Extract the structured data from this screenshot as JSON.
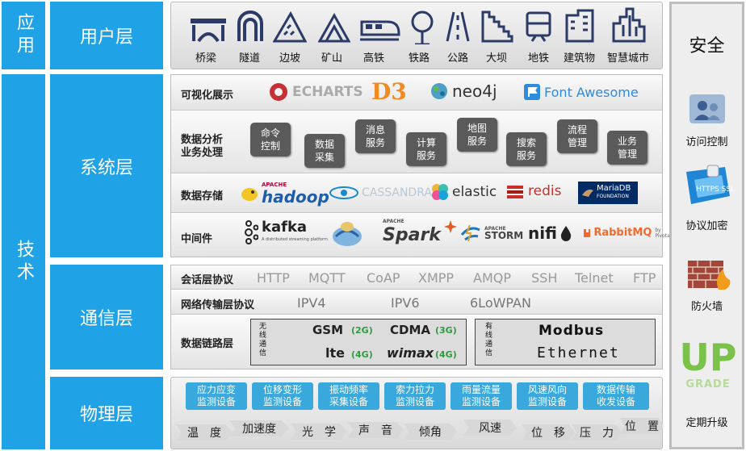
{
  "left_groups": [
    {
      "id": "app",
      "label": "应用"
    },
    {
      "id": "tech",
      "label": "技术"
    }
  ],
  "layers": [
    {
      "id": "user",
      "label": "用户层"
    },
    {
      "id": "system",
      "label": "系统层"
    },
    {
      "id": "comm",
      "label": "通信层"
    },
    {
      "id": "physical",
      "label": "物理层"
    }
  ],
  "user_layer": {
    "items": [
      {
        "label": "桥梁",
        "icon": "bridge-icon"
      },
      {
        "label": "隧道",
        "icon": "tunnel-icon"
      },
      {
        "label": "边坡",
        "icon": "slope-icon"
      },
      {
        "label": "矿山",
        "icon": "mountain-icon"
      },
      {
        "label": "高铁",
        "icon": "bullet-train-icon"
      },
      {
        "label": "铁路",
        "icon": "railway-sign-icon"
      },
      {
        "label": "公路",
        "icon": "road-icon"
      },
      {
        "label": "大坝",
        "icon": "dam-icon"
      },
      {
        "label": "地铁",
        "icon": "subway-icon"
      },
      {
        "label": "建筑物",
        "icon": "building-icon"
      },
      {
        "label": "智慧城市",
        "icon": "city-icon"
      }
    ]
  },
  "system_layer": {
    "viz": {
      "label": "可视化展示",
      "logos": [
        "ECHARTS",
        "D3",
        "neo4j",
        "Font Awesome"
      ]
    },
    "analysis": {
      "label1": "数据分析",
      "label2": "业务处理",
      "services": [
        {
          "l1": "命令",
          "l2": "控制"
        },
        {
          "l1": "数据",
          "l2": "采集"
        },
        {
          "l1": "消息",
          "l2": "服务"
        },
        {
          "l1": "计算",
          "l2": "服务"
        },
        {
          "l1": "地图",
          "l2": "服务"
        },
        {
          "l1": "搜索",
          "l2": "服务"
        },
        {
          "l1": "流程",
          "l2": "管理"
        },
        {
          "l1": "业务",
          "l2": "管理"
        }
      ]
    },
    "storage": {
      "label": "数据存储",
      "hadoop_top": "APACHE",
      "hadoop": "hadoop",
      "cassandra": "CASSANDRA",
      "elastic": "elastic",
      "redis": "redis",
      "mariadb": "MariaDB",
      "mariadb_sub": "FOUNDATION"
    },
    "middleware": {
      "label": "中间件",
      "kafka": "kafka",
      "kafka_sub": "A distributed streaming platform",
      "spark_top": "APACHE",
      "spark": "Spark",
      "storm_top": "APACHE",
      "storm": "STORM",
      "nifi": "nifi",
      "rabbitmq": "RabbitMQ",
      "rabbitmq_by": "by Pivotal"
    }
  },
  "comm_layer": {
    "session": {
      "label": "会话层协议",
      "protocols": [
        "HTTP",
        "MQTT",
        "CoAP",
        "XMPP",
        "AMQP",
        "SSH",
        "Telnet",
        "FTP"
      ]
    },
    "network": {
      "label": "网络传输层协议",
      "protocols": [
        "IPV4",
        "IPV6",
        "6LoWPAN"
      ]
    },
    "datalink": {
      "label": "数据链路层",
      "wireless": {
        "label": "无线通信",
        "gsm": "GSM",
        "gsm_gen": "(2G)",
        "cdma": "CDMA",
        "cdma_gen": "(3G)",
        "lte": "lte",
        "lte_gen": "(4G)",
        "wimax": "wimax",
        "wimax_gen": "(4G)"
      },
      "wired": {
        "label": "有线通信",
        "modbus": "Modbus",
        "ethernet": "Ethernet"
      }
    }
  },
  "physical_layer": {
    "sensors": [
      {
        "l1": "应力应变",
        "l2": "监测设备"
      },
      {
        "l1": "位移变形",
        "l2": "监测设备"
      },
      {
        "l1": "振动频率",
        "l2": "采集设备"
      },
      {
        "l1": "索力拉力",
        "l2": "监测设备"
      },
      {
        "l1": "雨量流量",
        "l2": "监测设备"
      },
      {
        "l1": "风速风向",
        "l2": "监测设备"
      },
      {
        "l1": "数据传输",
        "l2": "收发设备"
      }
    ],
    "quantities": [
      "温　度",
      "加速度",
      "光　学",
      "声　音",
      "倾角",
      "风速",
      "位　移",
      "压　力",
      "位　置"
    ]
  },
  "security": {
    "title": "安全",
    "items": [
      {
        "label": "访问控制",
        "icon": "access-control-icon"
      },
      {
        "label": "协议加密",
        "icon": "https-ssl-icon"
      },
      {
        "label": "防火墙",
        "icon": "firewall-icon"
      },
      {
        "label": "定期升级",
        "icon": "upgrade-icon",
        "logo_top": "UP",
        "logo_bottom": "GRADE"
      }
    ]
  },
  "colors": {
    "layer_blue": "#1fa3e6",
    "sensor_blue": "#38a8dd",
    "icon_navy": "#2b3a67"
  }
}
